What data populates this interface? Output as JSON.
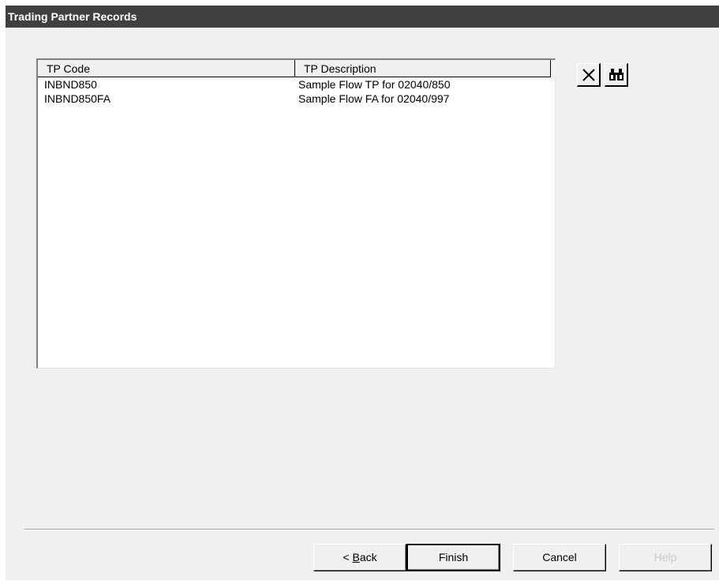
{
  "window": {
    "title": "Trading Partner Records"
  },
  "list": {
    "columns": [
      "TP Code",
      "TP Description"
    ],
    "rows": [
      {
        "code": "INBND850",
        "description": "Sample Flow TP for 02040/850"
      },
      {
        "code": "INBND850FA",
        "description": "Sample Flow FA for 02040/997"
      }
    ]
  },
  "toolbar": {
    "delete_icon": "delete-x-icon",
    "find_icon": "binoculars-icon"
  },
  "buttons": {
    "back_prefix": "< ",
    "back_mnemonic": "B",
    "back_rest": "ack",
    "finish": "Finish",
    "cancel": "Cancel",
    "help": "Help"
  }
}
